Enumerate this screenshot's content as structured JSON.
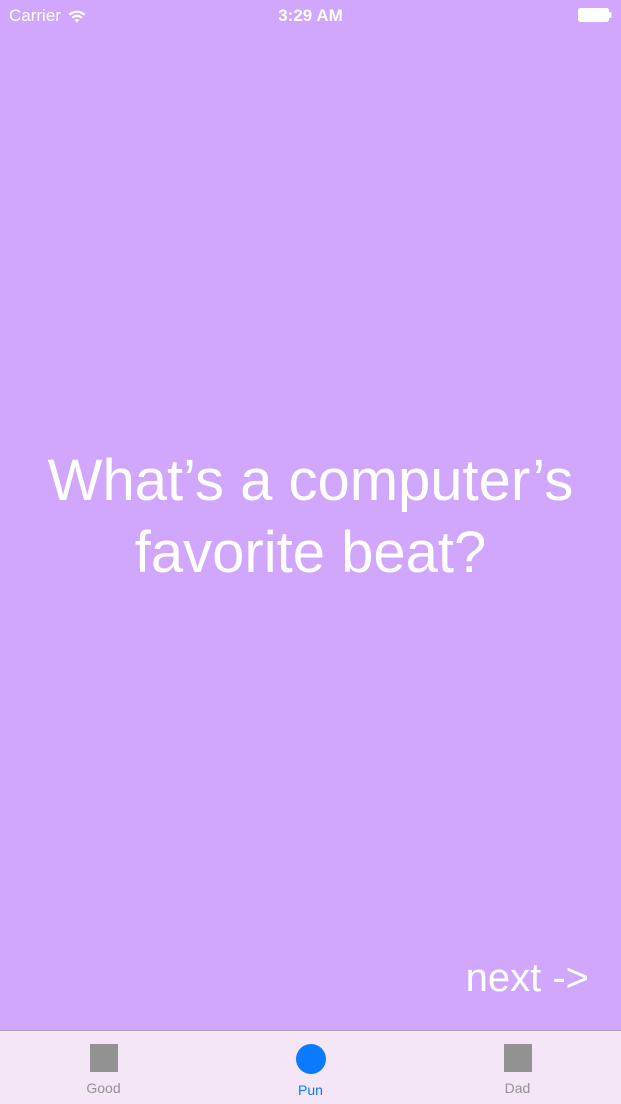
{
  "status_bar": {
    "carrier": "Carrier",
    "time": "3:29 AM"
  },
  "joke": {
    "text": "What’s a computer’s favorite beat?"
  },
  "next_label": "next ->",
  "tabs": [
    {
      "label": "Good",
      "icon": "square-icon"
    },
    {
      "label": "Pun",
      "icon": "circle-icon",
      "active": true
    },
    {
      "label": "Dad",
      "icon": "square-icon"
    }
  ],
  "colors": {
    "background": "#d1a7fd",
    "tab_bar": "#f4e5f7",
    "active_tint": "#0a7aff",
    "inactive_tint": "#929292"
  }
}
